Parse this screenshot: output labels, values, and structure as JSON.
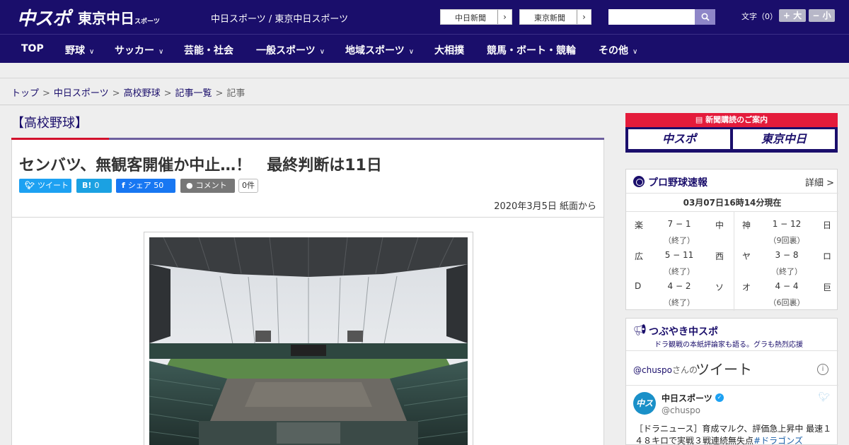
{
  "header": {
    "logo_chuspo": "中スポ",
    "logo_tokyo": "東京中日",
    "logo_tokyo_small": "スポーツ",
    "site_names": "中日スポーツ / 東京中日スポーツ",
    "links": [
      {
        "label": "中日新聞",
        "arrow": "›"
      },
      {
        "label": "東京新聞",
        "arrow": "›"
      }
    ],
    "search_value": "",
    "font_label": "文字（0）",
    "font_bigger": "+ 大",
    "font_smaller": "− 小"
  },
  "nav": [
    {
      "label": "TOP",
      "chevron": ""
    },
    {
      "label": "野球",
      "chevron": "∨"
    },
    {
      "label": "サッカー",
      "chevron": "∨"
    },
    {
      "label": "芸能・社会",
      "chevron": ""
    },
    {
      "label": "一般スポーツ",
      "chevron": "∨"
    },
    {
      "label": "地域スポーツ",
      "chevron": "∨"
    },
    {
      "label": "大相撲",
      "chevron": ""
    },
    {
      "label": "競馬・ボート・競輪",
      "chevron": ""
    },
    {
      "label": "その他",
      "chevron": "∨"
    }
  ],
  "breadcrumb": {
    "items": [
      "トップ",
      "中日スポーツ",
      "高校野球",
      "記事一覧"
    ],
    "current": "記事",
    "separator": ">"
  },
  "article": {
    "category": "【高校野球】",
    "title": "センバツ、無観客開催か中止…！　最終判断は11日",
    "share": {
      "tweet": "ツイート",
      "hatena_icon": "B!",
      "hatena_count": "0",
      "facebook_label": "シェア",
      "facebook_count": "50",
      "comment_label": "コメント",
      "comment_count": "0件"
    },
    "date": "2020年3月5日 紙面から"
  },
  "sidebar": {
    "subscribe": {
      "heading": "新聞購読のご案内",
      "logo_left": "中スポ",
      "logo_right": "東京中日"
    },
    "baseball": {
      "title": "プロ野球速報",
      "detail": "詳細 >",
      "time": "03月07日16時14分現在",
      "games": [
        {
          "team1": "楽",
          "score": "7 − 1",
          "team2": "中",
          "status": "（終了）"
        },
        {
          "team1": "神",
          "score": "1 − 12",
          "team2": "日",
          "status": "（9回裏）"
        },
        {
          "team1": "広",
          "score": "5 − 11",
          "team2": "西",
          "status": "（終了）"
        },
        {
          "team1": "ヤ",
          "score": "3 − 8",
          "team2": "ロ",
          "status": "（終了）"
        },
        {
          "team1": "D",
          "score": "4 − 2",
          "team2": "ソ",
          "status": "（終了）"
        },
        {
          "team1": "オ",
          "score": "4 − 4",
          "team2": "巨",
          "status": "（6回裏）"
        }
      ]
    },
    "tweets": {
      "title": "つぶやき中スポ",
      "subtitle": "ドラ観戦の本紙評論家も語る。グラも熱烈応援",
      "handle": "@chuspo",
      "handle_suffix": "さんの",
      "label": "ツイート",
      "info": "i",
      "account_name": "中日スポーツ",
      "account_at": "@chuspo",
      "avatar_text": "中スポ",
      "text": "［ドラニュース］育成マルク、評価急上昇中 最速１４８キロで実戦３戦連続無失点",
      "tag": "#ドラゴンズ"
    }
  },
  "colors": {
    "brand_navy": "#1a0e6b",
    "accent_red": "#d2112c",
    "twitter_blue": "#1da1f2",
    "facebook_blue": "#1877f2",
    "hatena_blue": "#1ba1e2"
  }
}
